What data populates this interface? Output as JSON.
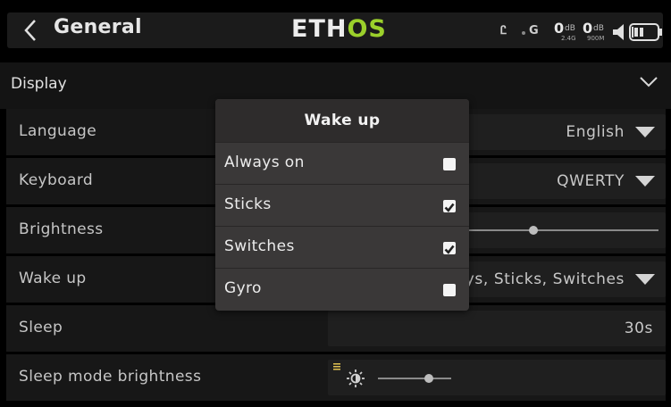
{
  "header": {
    "title": "General",
    "logo_part1": "ETH",
    "logo_part2": "OS",
    "status": {
      "timer_glyph": "Ꮭ",
      "gps_glyph": "G",
      "rssi1_value": "0",
      "rssi1_unit": "dB",
      "rssi1_band": "2.4G",
      "rssi2_value": "0",
      "rssi2_unit": "dB",
      "rssi2_band": "900M",
      "volume_icon": "speaker-icon",
      "battery_icon": "battery-icon"
    }
  },
  "section": {
    "label": "Display",
    "icon": "chevron-down-icon"
  },
  "settings": [
    {
      "label": "Language",
      "value": "English"
    },
    {
      "label": "Keyboard",
      "value": "QWERTY"
    },
    {
      "label": "Brightness",
      "value": ""
    },
    {
      "label": "Wake up",
      "value": "ys, Sticks, Switches"
    },
    {
      "label": "Sleep",
      "value": "30s"
    },
    {
      "label": "Sleep mode brightness",
      "value": ""
    }
  ],
  "dialog": {
    "title": "Wake up",
    "options": [
      {
        "label": "Always on",
        "checked": false
      },
      {
        "label": "Sticks",
        "checked": true
      },
      {
        "label": "Switches",
        "checked": true
      },
      {
        "label": "Gyro",
        "checked": false
      }
    ]
  },
  "colors": {
    "accent": "#9bd02b",
    "background": "#000000",
    "dialog": "#3a3838"
  }
}
